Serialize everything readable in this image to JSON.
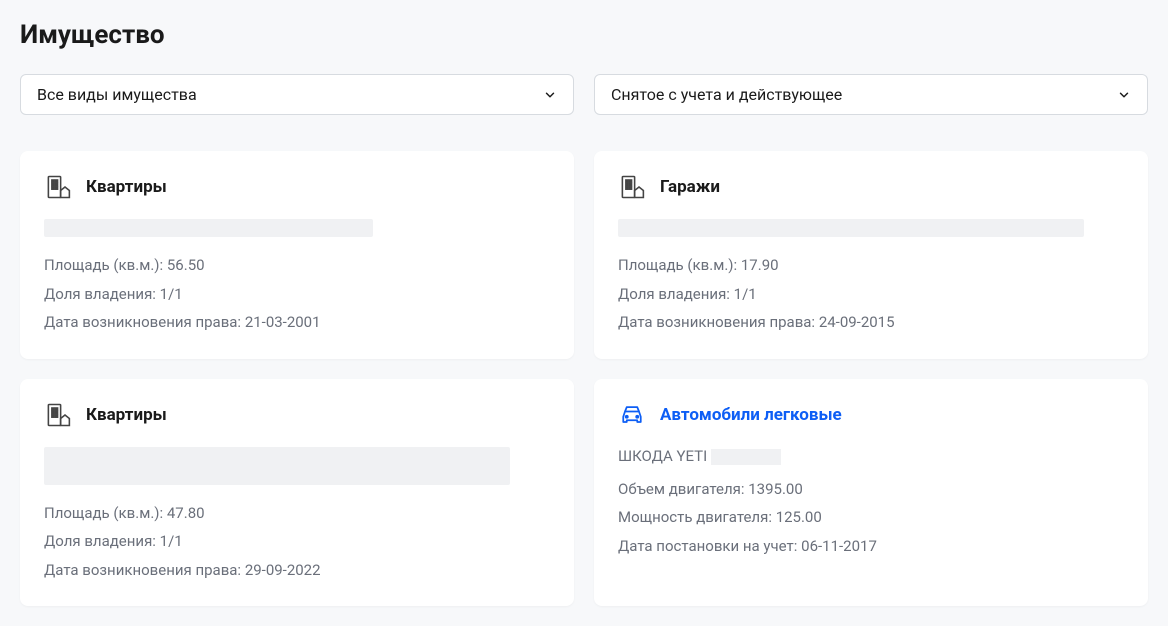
{
  "page_title": "Имущество",
  "filters": {
    "type_filter": "Все виды имущества",
    "status_filter": "Снятое с учета и действующее"
  },
  "cards": [
    {
      "title": "Квартиры",
      "props": [
        {
          "label": "Площадь (кв.м.):",
          "value": "56.50"
        },
        {
          "label": "Доля владения:",
          "value": "1/1"
        },
        {
          "label": "Дата возникновения права:",
          "value": "21-03-2001"
        }
      ]
    },
    {
      "title": "Гаражи",
      "props": [
        {
          "label": "Площадь (кв.м.):",
          "value": "17.90"
        },
        {
          "label": "Доля владения:",
          "value": "1/1"
        },
        {
          "label": "Дата возникновения права:",
          "value": "24-09-2015"
        }
      ]
    },
    {
      "title": "Квартиры",
      "props": [
        {
          "label": "Площадь (кв.м.):",
          "value": "47.80"
        },
        {
          "label": "Доля владения:",
          "value": "1/1"
        },
        {
          "label": "Дата возникновения права:",
          "value": "29-09-2022"
        }
      ]
    },
    {
      "title": "Автомобили легковые",
      "car_name": "ШКОДА YETI",
      "props": [
        {
          "label": "Объем двигателя:",
          "value": "1395.00"
        },
        {
          "label": "Мощность двигателя:",
          "value": "125.00"
        },
        {
          "label": "Дата постановки на учет:",
          "value": "06-11-2017"
        }
      ]
    }
  ]
}
